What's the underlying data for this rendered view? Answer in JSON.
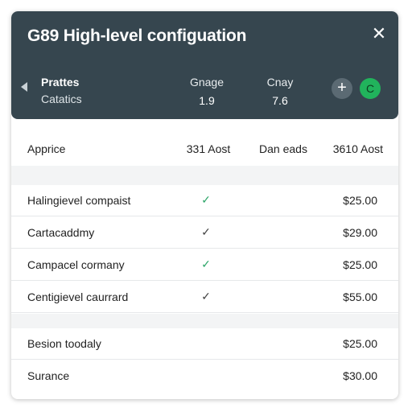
{
  "header": {
    "title": "G89 High-level configuation",
    "close_glyph": "✕",
    "summary_name": "Prattes",
    "summary_sub": "Catatics",
    "metrics": [
      {
        "label": "Gnage",
        "value": "1.9"
      },
      {
        "label": "Cnay",
        "value": "7.6"
      }
    ],
    "add_glyph": "+",
    "avatar_letter": "C",
    "colors": {
      "header_bg": "#36464f",
      "avatar": "#21b35c",
      "check_green": "#2ea66a"
    }
  },
  "columns": [
    "Apprice",
    "331 Aost",
    "Dan eads",
    "3610 Aost"
  ],
  "items": [
    {
      "name": "Halingievel compaist",
      "check": "✓",
      "check_color": "green",
      "price": "$25.00"
    },
    {
      "name": "Cartacaddmy",
      "check": "✓",
      "check_color": "dark",
      "price": "$29.00"
    },
    {
      "name": "Campacel cormany",
      "check": "✓",
      "check_color": "green",
      "price": "$25.00"
    },
    {
      "name": "Centigievel caurrard",
      "check": "✓",
      "check_color": "dark",
      "price": "$55.00"
    }
  ],
  "extras": [
    {
      "name": "Besion toodaly",
      "price": "$25.00"
    },
    {
      "name": "Surance",
      "price": "$30.00"
    }
  ],
  "icons": [
    "close-icon",
    "back-chevron-icon",
    "plus-icon",
    "check-icon"
  ]
}
